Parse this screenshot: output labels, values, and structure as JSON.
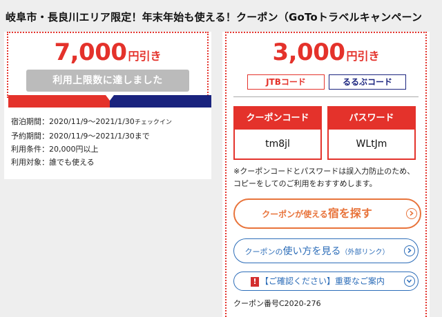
{
  "page_title": "岐阜市・長良川エリア限定！年末年始も使える！クーポン（GoToトラベルキャンペーン",
  "left_card": {
    "amount": "7,000",
    "suffix": "円引き",
    "limit_label": "利用上限数に達しました",
    "details": [
      {
        "label": "宿泊期間：",
        "value": "2020/11/9〜2021/1/30",
        "extra": "チェックイン"
      },
      {
        "label": "予約期間：",
        "value": "2020/11/9〜2021/1/30まで",
        "extra": ""
      },
      {
        "label": "利用条件：",
        "value": "20,000円以上",
        "extra": ""
      },
      {
        "label": "利用対象：",
        "value": "誰でも使える",
        "extra": ""
      }
    ]
  },
  "right_card": {
    "amount": "3,000",
    "suffix": "円引き",
    "tags": {
      "jtb": "JTBコード",
      "rurubu": "るるぶコード"
    },
    "coupon_code": {
      "header": "クーポンコード",
      "value": "tm8jl"
    },
    "password": {
      "header": "パスワード",
      "value": "WLtJm"
    },
    "note": "※クーポンコードとパスワードは誤入力防止のため、コピーをしてのご利用をおすすめします。",
    "search_button": {
      "part1": "クーポンが使える",
      "part2": "宿を探す"
    },
    "howto_button": {
      "part1": "クーポンの",
      "part2": "使い方を見る",
      "part3": "（外部リンク）"
    },
    "notice_button": {
      "badge": "!",
      "label": "【ご確認ください】重要なご案内"
    },
    "coupon_number": "クーポン番号C2020-276"
  },
  "colors": {
    "accent_red": "#e4322b",
    "navy": "#1a237e",
    "orange": "#e8733a",
    "link_blue": "#2b6cb8",
    "disabled_gray": "#bbbbbb"
  },
  "icons": [
    "chevron-right-icon",
    "chevron-down-icon",
    "exclamation-icon"
  ]
}
